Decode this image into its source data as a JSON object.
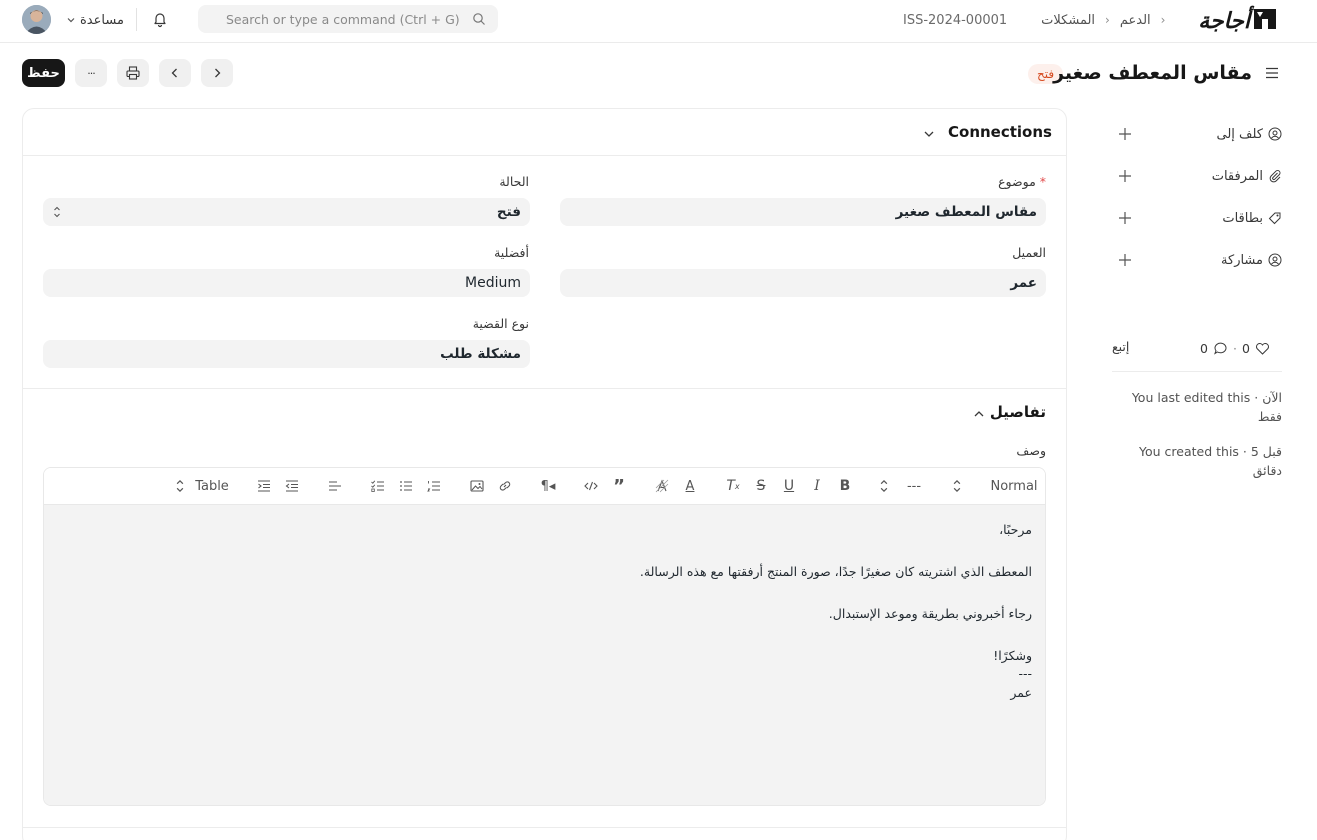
{
  "navbar": {
    "help_label": "مساعدة",
    "search_placeholder": "Search or type a command (Ctrl + G)",
    "breadcrumbs": [
      "الدعم",
      "المشكلات",
      "ISS-2024-00001"
    ],
    "logo_text": "أجاجة"
  },
  "page": {
    "title": "مقاس المعطف صغير",
    "status": "فتح",
    "save_label": "حفظ",
    "more_label": "···"
  },
  "connections": {
    "title": "Connections"
  },
  "form": {
    "subject": {
      "label": "موضوع",
      "required_mark": "*",
      "value": "مقاس المعطف صغير"
    },
    "status": {
      "label": "الحالة",
      "value": "فتح"
    },
    "customer": {
      "label": "العميل",
      "value": "عمر"
    },
    "priority": {
      "label": "أفضلية",
      "value": "Medium"
    },
    "issue_type": {
      "label": "نوع القضية",
      "value": "مشكلة طلب"
    }
  },
  "details": {
    "title": "تفاصيل",
    "description_label": "وصف",
    "toolbar": {
      "header_select": "Normal",
      "size_select": "---",
      "table_label": "Table"
    },
    "lines": [
      "مرحبًا،",
      "",
      "المعطف الذي اشتريته كان صغيرًا جدًا، صورة المنتج أرفقتها مع هذه الرسالة.",
      "",
      "رجاء أخبروني بطريقة وموعد الإستبدال.",
      "",
      "وشكرًا!",
      "---",
      "عمر"
    ]
  },
  "sidebar": {
    "assign_label": "كلف إلى",
    "attachments_label": "المرفقات",
    "tags_label": "بطاقات",
    "share_label": "مشاركة",
    "likes_count": "0",
    "comments_count": "0",
    "dot": "·",
    "follow_label": "إتبع",
    "activity": [
      "You last edited this · الآن فقط",
      "You created this · قبل 5 دقائق"
    ]
  }
}
